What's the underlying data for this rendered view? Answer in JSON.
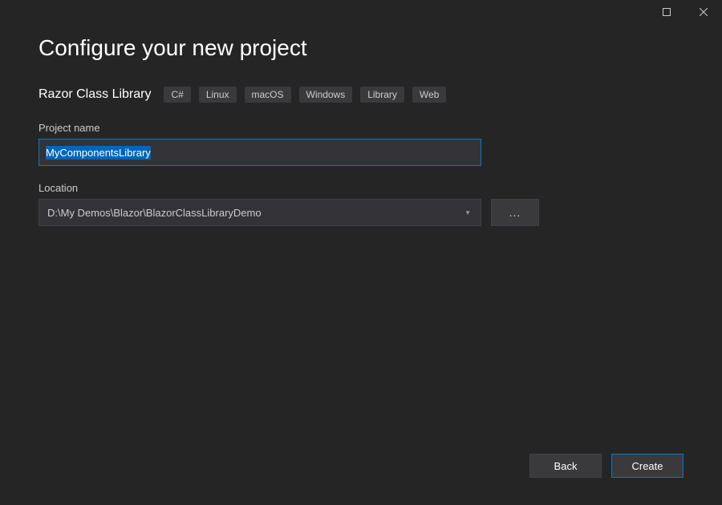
{
  "window": {
    "maximize_label": "Maximize",
    "close_label": "Close"
  },
  "header": {
    "title": "Configure your new project",
    "template_name": "Razor Class Library",
    "tags": [
      "C#",
      "Linux",
      "macOS",
      "Windows",
      "Library",
      "Web"
    ]
  },
  "fields": {
    "project_name": {
      "label": "Project name",
      "value": "MyComponentsLibrary"
    },
    "location": {
      "label": "Location",
      "value": "D:\\My Demos\\Blazor\\BlazorClassLibraryDemo",
      "browse_label": "..."
    }
  },
  "footer": {
    "back_label": "Back",
    "create_label": "Create"
  }
}
